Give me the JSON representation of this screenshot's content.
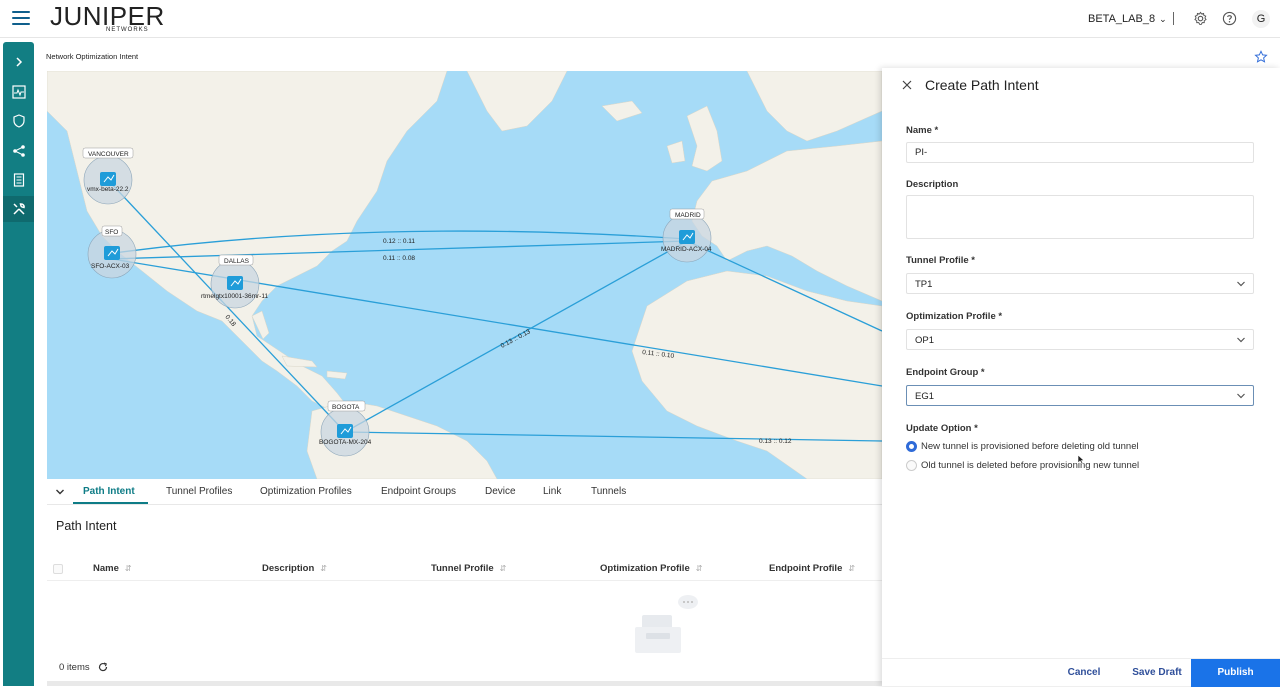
{
  "header": {
    "logo_main": "JUNIPER",
    "logo_sub": "NETWORKS",
    "org": "BETA_LAB_8",
    "avatar": "G"
  },
  "page": {
    "breadcrumb": "Network Optimization Intent"
  },
  "map": {
    "sites": [
      {
        "tag": "VANCOUVER",
        "device": "vmx-beta-22.2"
      },
      {
        "tag": "SFO",
        "device": "SFO-ACX-03"
      },
      {
        "tag": "DALLAS",
        "device": "rtmelgtx10001-36mr-11"
      },
      {
        "tag": "MADRID",
        "device": "MADRID-ACX-04"
      },
      {
        "tag": "BOGOTA",
        "device": "BOGOTA-MX-204"
      }
    ],
    "link_labels": [
      "0.12 :: 0.11",
      "0.11 :: 0.08",
      "0.13 :: 0.13",
      "0.11 :: 0.10",
      "0.13 :: 0.12",
      "0.18"
    ]
  },
  "tabs": [
    "Path Intent",
    "Tunnel Profiles",
    "Optimization Profiles",
    "Endpoint Groups",
    "Device",
    "Link",
    "Tunnels"
  ],
  "table": {
    "title": "Path Intent",
    "columns": [
      "Name",
      "Description",
      "Tunnel Profile",
      "Optimization Profile",
      "Endpoint Profile"
    ],
    "count": "0 items"
  },
  "panel": {
    "title": "Create Path Intent",
    "name_label": "Name *",
    "name_value": "PI-",
    "description_label": "Description",
    "tunnel_label": "Tunnel Profile *",
    "tunnel_value": "TP1",
    "optimization_label": "Optimization Profile *",
    "optimization_value": "OP1",
    "endpoint_label": "Endpoint Group *",
    "endpoint_value": "EG1",
    "update_label": "Update Option *",
    "update_options": [
      "New tunnel is provisioned before deleting old tunnel",
      "Old tunnel is deleted before provisioning new tunnel"
    ],
    "cancel": "Cancel",
    "save_draft": "Save Draft",
    "publish": "Publish"
  },
  "colors": {
    "accent": "#0e7c86",
    "sidebar": "#127e83",
    "publish": "#1a73e8",
    "link": "#2a9fd8",
    "ocean": "#a6dbf7",
    "land": "#f3f1e9"
  }
}
